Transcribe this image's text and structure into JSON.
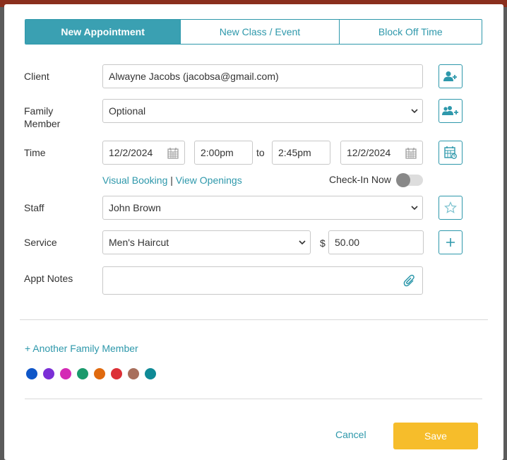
{
  "tabs": [
    {
      "label": "New Appointment",
      "active": true
    },
    {
      "label": "New Class / Event",
      "active": false
    },
    {
      "label": "Block Off Time",
      "active": false
    }
  ],
  "client": {
    "label": "Client",
    "value": "Alwayne Jacobs (jacobsa@gmail.com)"
  },
  "family": {
    "label_line1": "Family",
    "label_line2": "Member",
    "value": "Optional"
  },
  "time": {
    "label": "Time",
    "start_date": "12/2/2024",
    "start_time": "2:00pm",
    "to_label": "to",
    "end_time": "2:45pm",
    "end_date": "12/2/2024"
  },
  "links": {
    "visual_booking": "Visual Booking",
    "separator": "|",
    "view_openings": "View Openings"
  },
  "checkin": {
    "label": "Check-In Now",
    "on": false
  },
  "staff": {
    "label": "Staff",
    "value": "John Brown"
  },
  "service": {
    "label": "Service",
    "value": "Men's Haircut",
    "currency": "$",
    "price": "50.00"
  },
  "notes": {
    "label": "Appt Notes",
    "value": ""
  },
  "another_family": "+ Another Family Member",
  "colors": [
    "#0f56c8",
    "#7b2fd6",
    "#d42ab5",
    "#1a9a6c",
    "#e06a0e",
    "#dc2f36",
    "#a86f5c",
    "#0f8a96"
  ],
  "actions": {
    "cancel": "Cancel",
    "save": "Save"
  },
  "accent": "#2e98ab",
  "save_color": "#f6bd2b"
}
